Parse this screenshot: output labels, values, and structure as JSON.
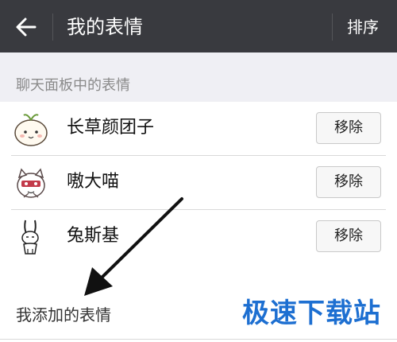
{
  "header": {
    "title": "我的表情",
    "sort_label": "排序"
  },
  "panel_section": {
    "title": "聊天面板中的表情",
    "items": [
      {
        "name": "长草颜团子",
        "action_label": "移除"
      },
      {
        "name": "嗷大喵",
        "action_label": "移除"
      },
      {
        "name": "兔斯基",
        "action_label": "移除"
      }
    ]
  },
  "added_section": {
    "title": "我添加的表情"
  },
  "watermark": "极速下载站",
  "colors": {
    "topbar": "#393a3f",
    "background": "#efeff4",
    "watermark": "#1d6fd1"
  }
}
